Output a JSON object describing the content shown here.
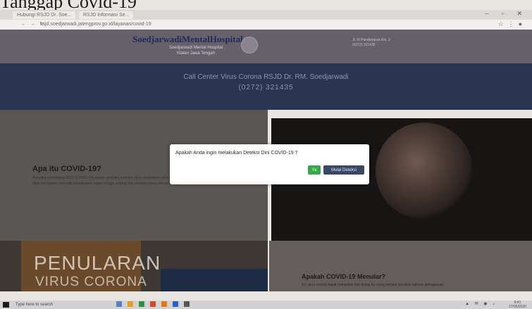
{
  "document": {
    "title": "Tanggap Covid-19"
  },
  "browser": {
    "tabs": [
      "Hubungi RSJD Dr. Soe...",
      "RSJD Informasi Se..."
    ],
    "url": "rsjd.soedjarwadi.jatengprov.go.id/layanan/covid-19",
    "icons": [
      "back-icon",
      "forward-icon",
      "reload-icon",
      "star-icon",
      "menu-icon",
      "profile-icon"
    ]
  },
  "site": {
    "logo_main": "SoedjarwadiMentalHospital",
    "logo_sub": [
      "Soedjarwadi Mental Hospital",
      "Klaten Jawa Tengah"
    ],
    "contact": [
      "Jl. Ki Pandanaran Km. 2",
      "(0272) 321435"
    ]
  },
  "call_center": {
    "title": "Call Center Virus Corona RSJD Dr. RM. Soedjarwadi",
    "phone": "(0272) 321435"
  },
  "info": {
    "heading": "Apa itu COVID-19?",
    "body": "Penyakit coronavirus 2019 (COVID-19) adalah penyakit menular yang disebabkan oleh virus corona. Kebanyakan orang yang terinfeksi akan mengalami penyakit pernapasan ringan hingga sedang dan sembuh tanpa memerlukan perawatan khusus."
  },
  "spread": {
    "line1": "PENULARAN",
    "line2": "VIRUS CORONA",
    "heading": "Apakah COVID-19 Menular?",
    "body": "Ya, virus corona dapat menyebar dari orang ke orang melalui percikan saluran pernapasan."
  },
  "modal": {
    "question": "Apakah Anda ingin melakukan Deteksi Dini COVID-19 ?",
    "ok_label": "Ya",
    "start_label": "Mulai Deteksi"
  },
  "taskbar": {
    "search": "Type here to search",
    "time": "9:41",
    "date": "27/05/2020"
  }
}
